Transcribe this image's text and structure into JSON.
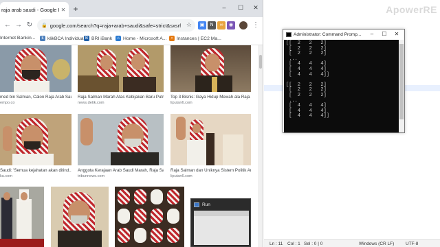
{
  "browser": {
    "tab_title": "raja arab saudi - Google Penelu",
    "url": "google.com/search?q=raja+arab+saudi&safe=strict&sxsrf=AC...",
    "bookmarks": [
      {
        "label": "Internet Bankin..."
      },
      {
        "label": "klikBCA Individual"
      },
      {
        "label": "BRI iBank"
      },
      {
        "label": "Home - Microsoft A..."
      },
      {
        "label": "Instances | EC2 Ma..."
      }
    ],
    "results": [
      {
        "caption": "med bin Salman, Calon Raja Arab Saudi ...",
        "source": "empo.co"
      },
      {
        "caption": "Raja Salman Marah Atas Kebijakan Baru Putra ...",
        "source": "news.detik.com"
      },
      {
        "caption": "Top 3 Bisnis: Gaya Hidup Mewah ala Raja Ara...",
        "source": "liputan6.com"
      },
      {
        "caption": "Saudi: 'Semua kejahatan akan ditind...",
        "source": "ku.com"
      },
      {
        "caption": "Anggota Kerajaan Arab Saudi Marah, Raja Sal...",
        "source": "tribunnews.com"
      },
      {
        "caption": "Raja Salman dan Uniknya Sistem Politik Arab ...",
        "source": "liputan6.com"
      }
    ]
  },
  "cmd": {
    "title": "Administrator: Command Promp...",
    "output": "[[  2   2   2]\n [  2   2   2]\n [  2   2   2]\n ...\n [  4   4   4]\n [  4   4   4]\n [  4   4   4]]\n\n[[  2   2   2]\n [  2   2   2]\n [  2   2   2]\n ...\n [  4   4   4]\n [  4   4   4]\n [  4   4   4]]"
  },
  "run_popup": {
    "label": "Run"
  },
  "editor": {
    "watermark": "ApowerRE",
    "status": {
      "line": "Ln : 11",
      "col": "Col : 1",
      "sel": "Sel : 0 | 0",
      "eol": "Windows (CR LF)",
      "encoding": "UTF-8"
    }
  },
  "colors": {
    "chrome_tabstrip": "#dee1e6",
    "console_bg": "#0c0c0c",
    "console_text": "#cccccc",
    "ghutra_red": "#c0272d"
  }
}
